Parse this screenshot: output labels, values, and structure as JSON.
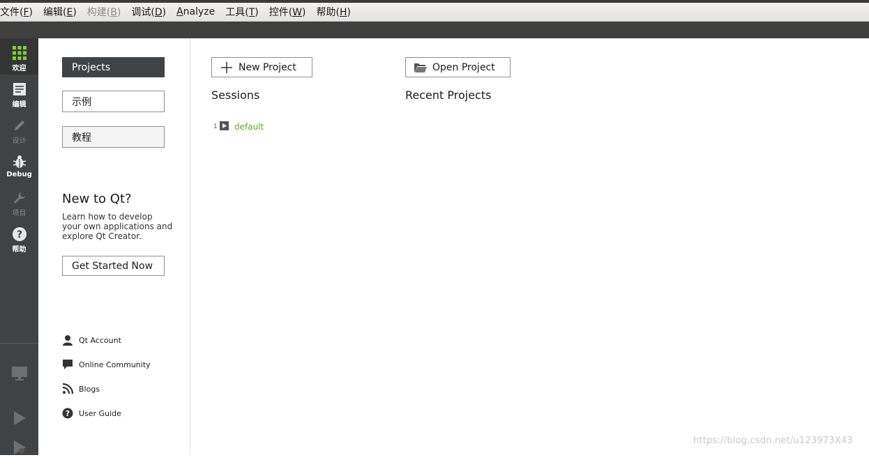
{
  "menu": [
    {
      "label": "文件(",
      "key": "F",
      "tail": ")",
      "disabled": false
    },
    {
      "label": "编辑(",
      "key": "E",
      "tail": ")",
      "disabled": false
    },
    {
      "label": "构建(",
      "key": "B",
      "tail": ")",
      "disabled": true
    },
    {
      "label": "调试(",
      "key": "D",
      "tail": ")",
      "disabled": false
    },
    {
      "label": "",
      "key": "A",
      "tail": "nalyze",
      "disabled": false
    },
    {
      "label": "工具(",
      "key": "T",
      "tail": ")",
      "disabled": false
    },
    {
      "label": "控件(",
      "key": "W",
      "tail": ")",
      "disabled": false
    },
    {
      "label": "帮助(",
      "key": "H",
      "tail": ")",
      "disabled": false
    }
  ],
  "modes": {
    "welcome": "欢迎",
    "edit": "编辑",
    "design": "设计",
    "debug": "Debug",
    "projects": "项目",
    "help": "帮助"
  },
  "sidebar": {
    "projects": "Projects",
    "examples": "示例",
    "tutorials": "教程",
    "new_title": "New to Qt?",
    "new_desc": "Learn how to develop your own applications and explore Qt Creator.",
    "get_started": "Get Started Now",
    "links": {
      "account": "Qt Account",
      "community": "Online Community",
      "blogs": "Blogs",
      "guide": "User Guide"
    }
  },
  "main": {
    "new_project": "New Project",
    "open_project": "Open Project",
    "sessions_title": "Sessions",
    "recent_title": "Recent Projects",
    "sessions": [
      {
        "num": "1",
        "name": "default"
      }
    ]
  },
  "watermark": "https://blog.csdn.net/u123973X43",
  "colors": {
    "accent": "#5eaa1e",
    "dark": "#404244"
  }
}
